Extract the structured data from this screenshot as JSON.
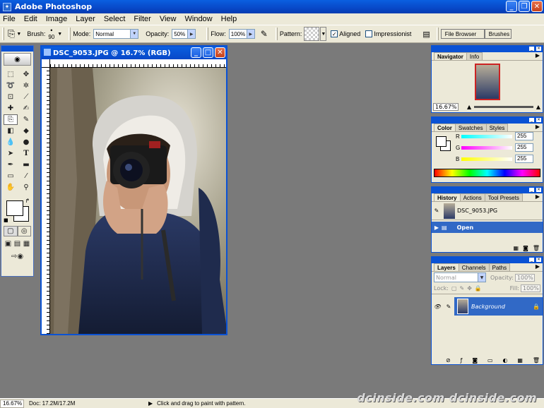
{
  "window": {
    "title": "Adobe Photoshop"
  },
  "menu": [
    "File",
    "Edit",
    "Image",
    "Layer",
    "Select",
    "Filter",
    "View",
    "Window",
    "Help"
  ],
  "options": {
    "brush_label": "Brush:",
    "brush_size": "90",
    "mode_label": "Mode:",
    "mode_value": "Normal",
    "opacity_label": "Opacity:",
    "opacity_value": "50%",
    "flow_label": "Flow:",
    "flow_value": "100%",
    "pattern_label": "Pattern:",
    "aligned_label": "Aligned",
    "aligned_checked": true,
    "impressionist_label": "Impressionist",
    "impressionist_checked": false,
    "file_browser": "File Browser",
    "brushes": "Brushes"
  },
  "document": {
    "title": "DSC_9053.JPG @ 16.7% (RGB)"
  },
  "navigator": {
    "tabs": [
      "Navigator",
      "Info"
    ],
    "zoom": "16.67%"
  },
  "color": {
    "tabs": [
      "Color",
      "Swatches",
      "Styles"
    ],
    "r_label": "R",
    "g_label": "G",
    "b_label": "B",
    "r": "255",
    "g": "255",
    "b": "255"
  },
  "history": {
    "tabs": [
      "History",
      "Actions",
      "Tool Presets"
    ],
    "snapshot": "DSC_9053.JPG",
    "state": "Open"
  },
  "layers": {
    "tabs": [
      "Layers",
      "Channels",
      "Paths"
    ],
    "blend": "Normal",
    "opacity_label": "Opacity:",
    "opacity": "100%",
    "lock_label": "Lock:",
    "fill_label": "Fill:",
    "fill": "100%",
    "layer_name": "Background"
  },
  "status": {
    "zoom": "16.67%",
    "doc": "Doc: 17.2M/17.2M",
    "hint": "Click and drag to paint with pattern."
  },
  "watermark": "dcinside.com dcinside.com",
  "colors": {
    "accent": "#0a52d4",
    "chrome": "#ece9d8",
    "workspace": "#7a7a7a"
  }
}
